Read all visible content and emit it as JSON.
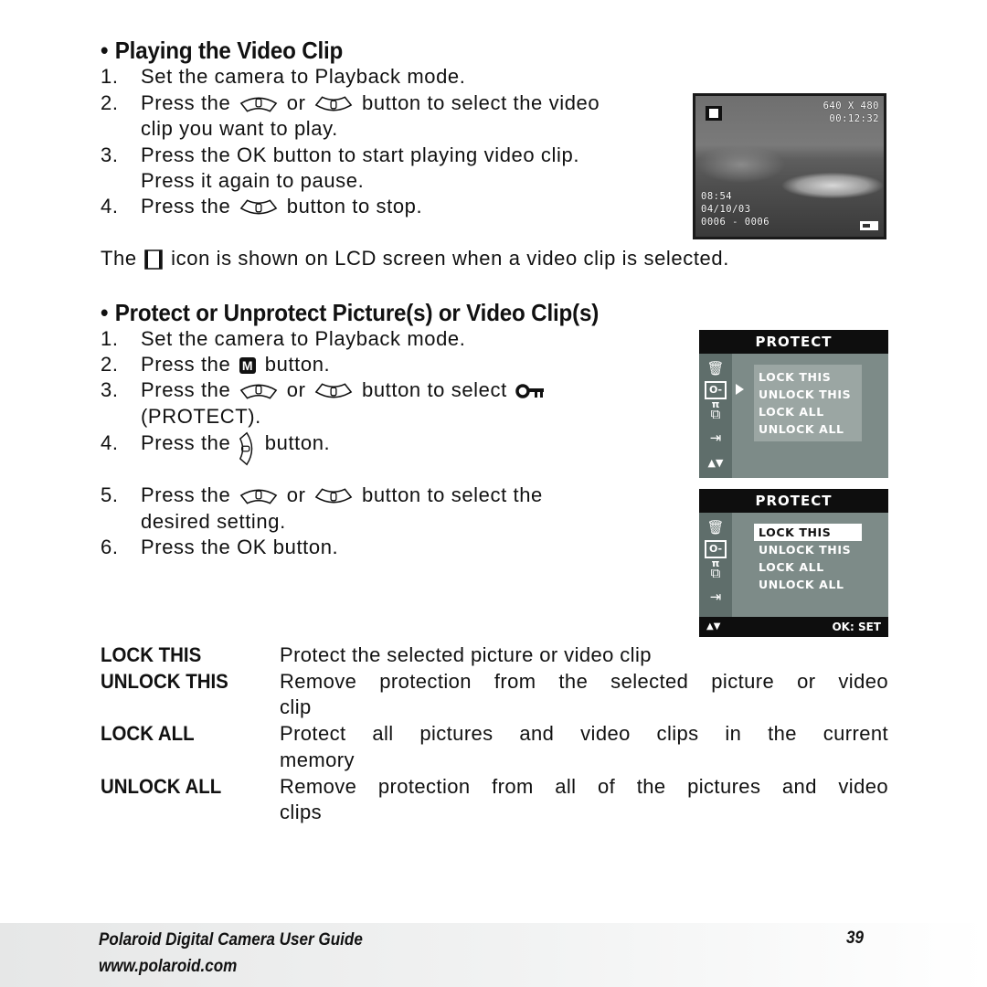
{
  "section1": {
    "heading": "Playing the Video Clip",
    "bullet": "•",
    "steps": [
      {
        "num": "1.",
        "lines": [
          "Set the camera to Playback mode."
        ]
      },
      {
        "num": "2.",
        "pre": "Press the",
        "mid": "or",
        "post": "button to select the video",
        "line2": "clip you want to play."
      },
      {
        "num": "3.",
        "line1": "Press the OK button to start playing video clip.",
        "line2": "Press it again to pause."
      },
      {
        "num": "4.",
        "pre": "Press the",
        "post": "button to stop."
      }
    ],
    "note_pre": "The",
    "note_post": "icon is shown on LCD screen when a video clip is selected.",
    "lcd": {
      "resolution": "640 X 480",
      "duration": "00:12:32",
      "time": "08:54",
      "date": "04/10/03",
      "counter": "0006 - 0006",
      "icons": [
        "video-clip-icon",
        "battery-icon"
      ]
    }
  },
  "section2": {
    "heading": "Protect or Unprotect Picture(s) or Video Clip(s)",
    "bullet": "•",
    "steps": [
      {
        "num": "1.",
        "text": "Set the camera to Playback mode."
      },
      {
        "num": "2.",
        "pre": "Press the",
        "post": "button."
      },
      {
        "num": "3.",
        "pre": "Press the",
        "mid": "or",
        "post": "button to select",
        "line2": "(PROTECT)."
      },
      {
        "num": "4.",
        "pre": "Press the",
        "post": "button."
      },
      {
        "num": "5.",
        "pre": "Press the",
        "mid": "or",
        "post": "button to select the",
        "line2": "desired setting."
      },
      {
        "num": "6.",
        "pre": "Press the",
        "ok": "OK",
        "post": "button."
      }
    ],
    "menus": [
      {
        "title": "PROTECT",
        "options": [
          "LOCK THIS",
          "UNLOCK THIS",
          "LOCK ALL",
          "UNLOCK ALL"
        ],
        "selected": null,
        "footer_right": ""
      },
      {
        "title": "PROTECT",
        "options": [
          "LOCK THIS",
          "UNLOCK THIS",
          "LOCK ALL",
          "UNLOCK ALL"
        ],
        "selected": 0,
        "footer_left": "▲▼",
        "footer_right": "OK: SET"
      }
    ],
    "side_icons": [
      "delete-icon",
      "protect-key-icon",
      "copy-card-icon",
      "import-icon",
      "up-down-icon"
    ],
    "definitions": [
      {
        "term": "LOCK THIS",
        "desc": "Protect the selected picture or video clip"
      },
      {
        "term": "UNLOCK THIS",
        "desc": "Remove protection from the selected picture or video",
        "desc2": "clip"
      },
      {
        "term": "LOCK ALL",
        "desc": "Protect all pictures and video clips in the current",
        "desc2": "memory"
      },
      {
        "term": "UNLOCK ALL",
        "desc": "Remove protection from all of the pictures and video",
        "desc2": "clips"
      }
    ]
  },
  "footer": {
    "title": "Polaroid Digital Camera User Guide",
    "url": "www.polaroid.com",
    "page": "39"
  }
}
